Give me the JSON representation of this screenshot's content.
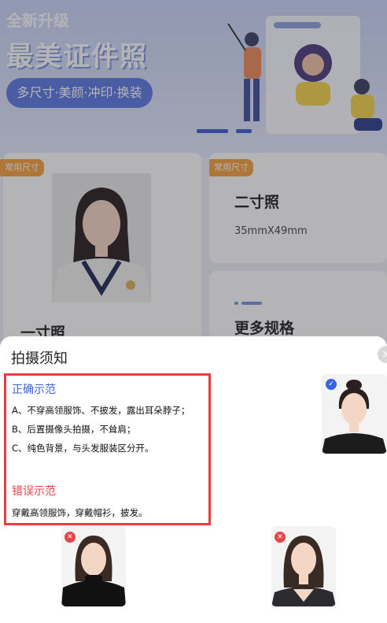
{
  "hero": {
    "badge": "全新升级",
    "title": "最美证件照",
    "pill": "多尺寸·美颜·冲印·换装"
  },
  "cards": {
    "one_inch": {
      "tag": "常用尺寸",
      "title": "一寸照"
    },
    "two_inch": {
      "tag": "常用尺寸",
      "title": "二寸照",
      "size": "35mmX49mm"
    },
    "more": {
      "title": "更多规格"
    }
  },
  "sheet": {
    "title": "拍摄须知",
    "close_icon": "close-icon",
    "correct": {
      "title": "正确示范",
      "lines": [
        "A、不穿高领服饰、不披发，露出耳朵脖子；",
        "B、后置摄像头拍摄，不耸肩；",
        "C、纯色背景，与头发服装区分开。"
      ]
    },
    "wrong": {
      "title": "错误示范",
      "lines": [
        "穿戴高领服饰，穿戴帽衫，披发。"
      ]
    }
  },
  "colors": {
    "accent_blue": "#3b64d6",
    "error_red": "#e8434a",
    "highlight_border": "#ea3b3e",
    "tag_orange": "#f6a13c"
  }
}
